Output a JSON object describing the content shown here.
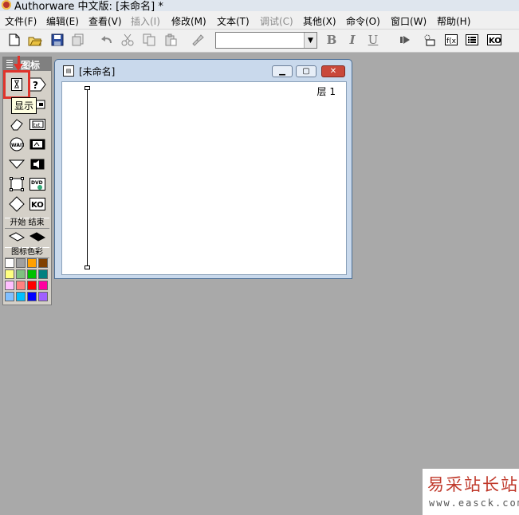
{
  "window": {
    "title": "Authorware 中文版: [未命名] *"
  },
  "menubar": {
    "items": [
      {
        "label": "文件(F)",
        "disabled": false
      },
      {
        "label": "编辑(E)",
        "disabled": false
      },
      {
        "label": "查看(V)",
        "disabled": false
      },
      {
        "label": "插入(I)",
        "disabled": true
      },
      {
        "label": "修改(M)",
        "disabled": false
      },
      {
        "label": "文本(T)",
        "disabled": false
      },
      {
        "label": "调试(C)",
        "disabled": true
      },
      {
        "label": "其他(X)",
        "disabled": false
      },
      {
        "label": "命令(O)",
        "disabled": false
      },
      {
        "label": "窗口(W)",
        "disabled": false
      },
      {
        "label": "帮助(H)",
        "disabled": false
      }
    ]
  },
  "toolbar": {
    "font_combo_value": "",
    "bold": "B",
    "italic": "I",
    "underline": "U"
  },
  "palette": {
    "title": "图标",
    "tooltip": "显示",
    "start_label": "开始",
    "end_label": "结束",
    "color_label": "图标色彩",
    "colors": [
      "#ffffff",
      "#a0a0a0",
      "#ffa000",
      "#804000",
      "#ffff80",
      "#80c080",
      "#00c000",
      "#008080",
      "#ffc0ff",
      "#ff8080",
      "#ff0000",
      "#ff00a0",
      "#80c0ff",
      "#00c0ff",
      "#0000ff",
      "#a060ff"
    ]
  },
  "document": {
    "title": "[未命名]",
    "level_label": "层 1"
  },
  "watermark": {
    "text": "易采站长站",
    "url": "www.easck.com"
  },
  "colors": {
    "highlight": "#e0342c",
    "workspace": "#a9a9a9"
  }
}
